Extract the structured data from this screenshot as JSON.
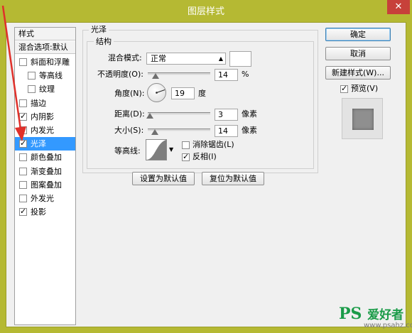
{
  "window": {
    "title": "图层样式",
    "close_symbol": "✕"
  },
  "style_list": {
    "header": "样式",
    "blend_options": "混合选项:默认",
    "items": [
      {
        "label": "斜面和浮雕",
        "checked": false,
        "selected": false,
        "sub": false
      },
      {
        "label": "等高线",
        "checked": false,
        "selected": false,
        "sub": true
      },
      {
        "label": "纹理",
        "checked": false,
        "selected": false,
        "sub": true
      },
      {
        "label": "描边",
        "checked": false,
        "selected": false,
        "sub": false
      },
      {
        "label": "内阴影",
        "checked": true,
        "selected": false,
        "sub": false
      },
      {
        "label": "内发光",
        "checked": true,
        "selected": false,
        "sub": false
      },
      {
        "label": "光泽",
        "checked": true,
        "selected": true,
        "sub": false
      },
      {
        "label": "颜色叠加",
        "checked": false,
        "selected": false,
        "sub": false
      },
      {
        "label": "渐变叠加",
        "checked": false,
        "selected": false,
        "sub": false
      },
      {
        "label": "图案叠加",
        "checked": false,
        "selected": false,
        "sub": false
      },
      {
        "label": "外发光",
        "checked": false,
        "selected": false,
        "sub": false
      },
      {
        "label": "投影",
        "checked": true,
        "selected": false,
        "sub": false
      }
    ],
    "check_glyph": "✓"
  },
  "satin": {
    "section_title": "光泽",
    "structure_title": "结构",
    "blend_mode_label": "混合模式:",
    "blend_mode_value": "正常",
    "opacity_label": "不透明度(O):",
    "opacity_value": "14",
    "opacity_unit": "%",
    "angle_label": "角度(N):",
    "angle_value": "19",
    "angle_unit": "度",
    "distance_label": "距离(D):",
    "distance_value": "3",
    "distance_unit": "像素",
    "size_label": "大小(S):",
    "size_value": "14",
    "size_unit": "像素",
    "contour_label": "等高线:",
    "antialias_label": "消除锯齿(L)",
    "antialias_checked": false,
    "invert_label": "反相(I)",
    "invert_checked": true,
    "set_default": "设置为默认值",
    "reset_default": "复位为默认值"
  },
  "buttons": {
    "ok": "确定",
    "cancel": "取消",
    "new_style": "新建样式(W)...",
    "preview_label": "预览(V)",
    "preview_checked": true
  },
  "watermark": {
    "logo": "PS",
    "logo_cn": "爱好者",
    "url": "www.psahz.com"
  },
  "colors": {
    "title_bar": "#b5b933",
    "selected": "#3399ff",
    "close": "#c7413a",
    "arrow": "#e0302a"
  }
}
